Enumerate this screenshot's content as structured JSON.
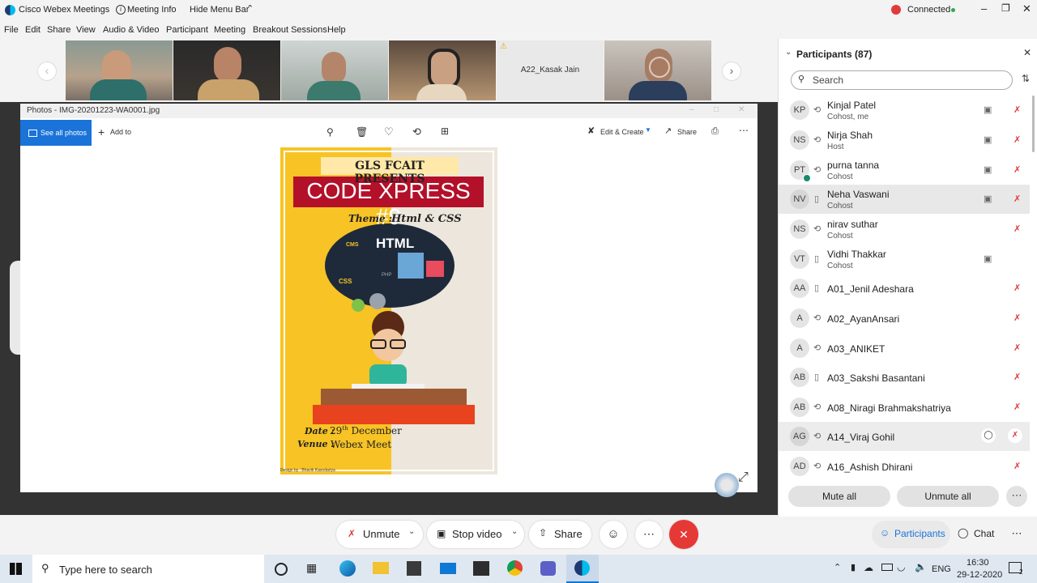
{
  "titlebar": {
    "app_title": "Cisco Webex Meetings",
    "meeting_info": "Meeting Info",
    "hide_menu_bar": "Hide Menu Bar",
    "status": "Connected"
  },
  "menubar": [
    "File",
    "Edit",
    "Share",
    "View",
    "Audio & Video",
    "Participant",
    "Meeting",
    "Breakout Sessions",
    "Help"
  ],
  "strip": {
    "tile_name": "A22_Kasak Jain"
  },
  "photos": {
    "title": "Photos - IMG-20201223-WA0001.jpg",
    "see_all": "See all photos",
    "add_to": "Add to",
    "edit_create": "Edit & Create",
    "share": "Share"
  },
  "poster": {
    "presents": "GLS FCAIT PRESENTS",
    "event": "CODE XPRESS #9",
    "theme_label": "Theme :",
    "theme_value": "Html & CSS",
    "html_word": "HTML",
    "css_word": "CSS",
    "cms_word": "CMS",
    "php_word": "PHP",
    "date_label": "Date :",
    "date_value": "29",
    "date_sup": "th",
    "date_month": "December",
    "venue_label": "Venue :",
    "venue_value": "Webex Meet",
    "credit": "Design by : Bhavik Kasodariya"
  },
  "participants": {
    "title": "Participants (87)",
    "search_placeholder": "Search",
    "mute_all": "Mute all",
    "unmute_all": "Unmute all",
    "list": [
      {
        "initials": "KP",
        "name": "Kinjal Patel",
        "role": "Cohost, me",
        "video": true
      },
      {
        "initials": "NS",
        "name": "Nirja Shah",
        "role": "Host",
        "video": true
      },
      {
        "initials": "PT",
        "name": "purna tanna",
        "role": "Cohost",
        "video": true
      },
      {
        "initials": "NV",
        "name": "Neha Vaswani",
        "role": "Cohost",
        "video": true
      },
      {
        "initials": "NS",
        "name": "nirav suthar",
        "role": "Cohost",
        "video": false
      },
      {
        "initials": "VT",
        "name": "Vidhi Thakkar",
        "role": "Cohost",
        "video": true
      },
      {
        "initials": "AA",
        "name": "A01_Jenil Adeshara",
        "role": "",
        "video": false
      },
      {
        "initials": "A",
        "name": "A02_AyanAnsari",
        "role": "",
        "video": false
      },
      {
        "initials": "A",
        "name": "A03_ANIKET",
        "role": "",
        "video": false
      },
      {
        "initials": "AB",
        "name": "A03_Sakshi Basantani",
        "role": "",
        "video": false
      },
      {
        "initials": "AB",
        "name": "A08_Niragi Brahmakshatriya",
        "role": "",
        "video": false
      },
      {
        "initials": "AG",
        "name": "A14_Viraj Gohil",
        "role": "",
        "video": false
      },
      {
        "initials": "AD",
        "name": "A16_Ashish Dhirani",
        "role": "",
        "video": false
      }
    ]
  },
  "controls": {
    "unmute": "Unmute",
    "stop_video": "Stop video",
    "share": "Share",
    "participants": "Participants",
    "chat": "Chat"
  },
  "taskbar": {
    "search": "Type here to search",
    "lang": "ENG",
    "time": "16:30",
    "date": "29-12-2020",
    "notif": "2"
  },
  "colors": {
    "accent": "#1a73d9",
    "end_red": "#e53935",
    "mic_red": "#e03a3a",
    "poster_yellow": "#f7c325",
    "poster_red": "#c8102e"
  }
}
